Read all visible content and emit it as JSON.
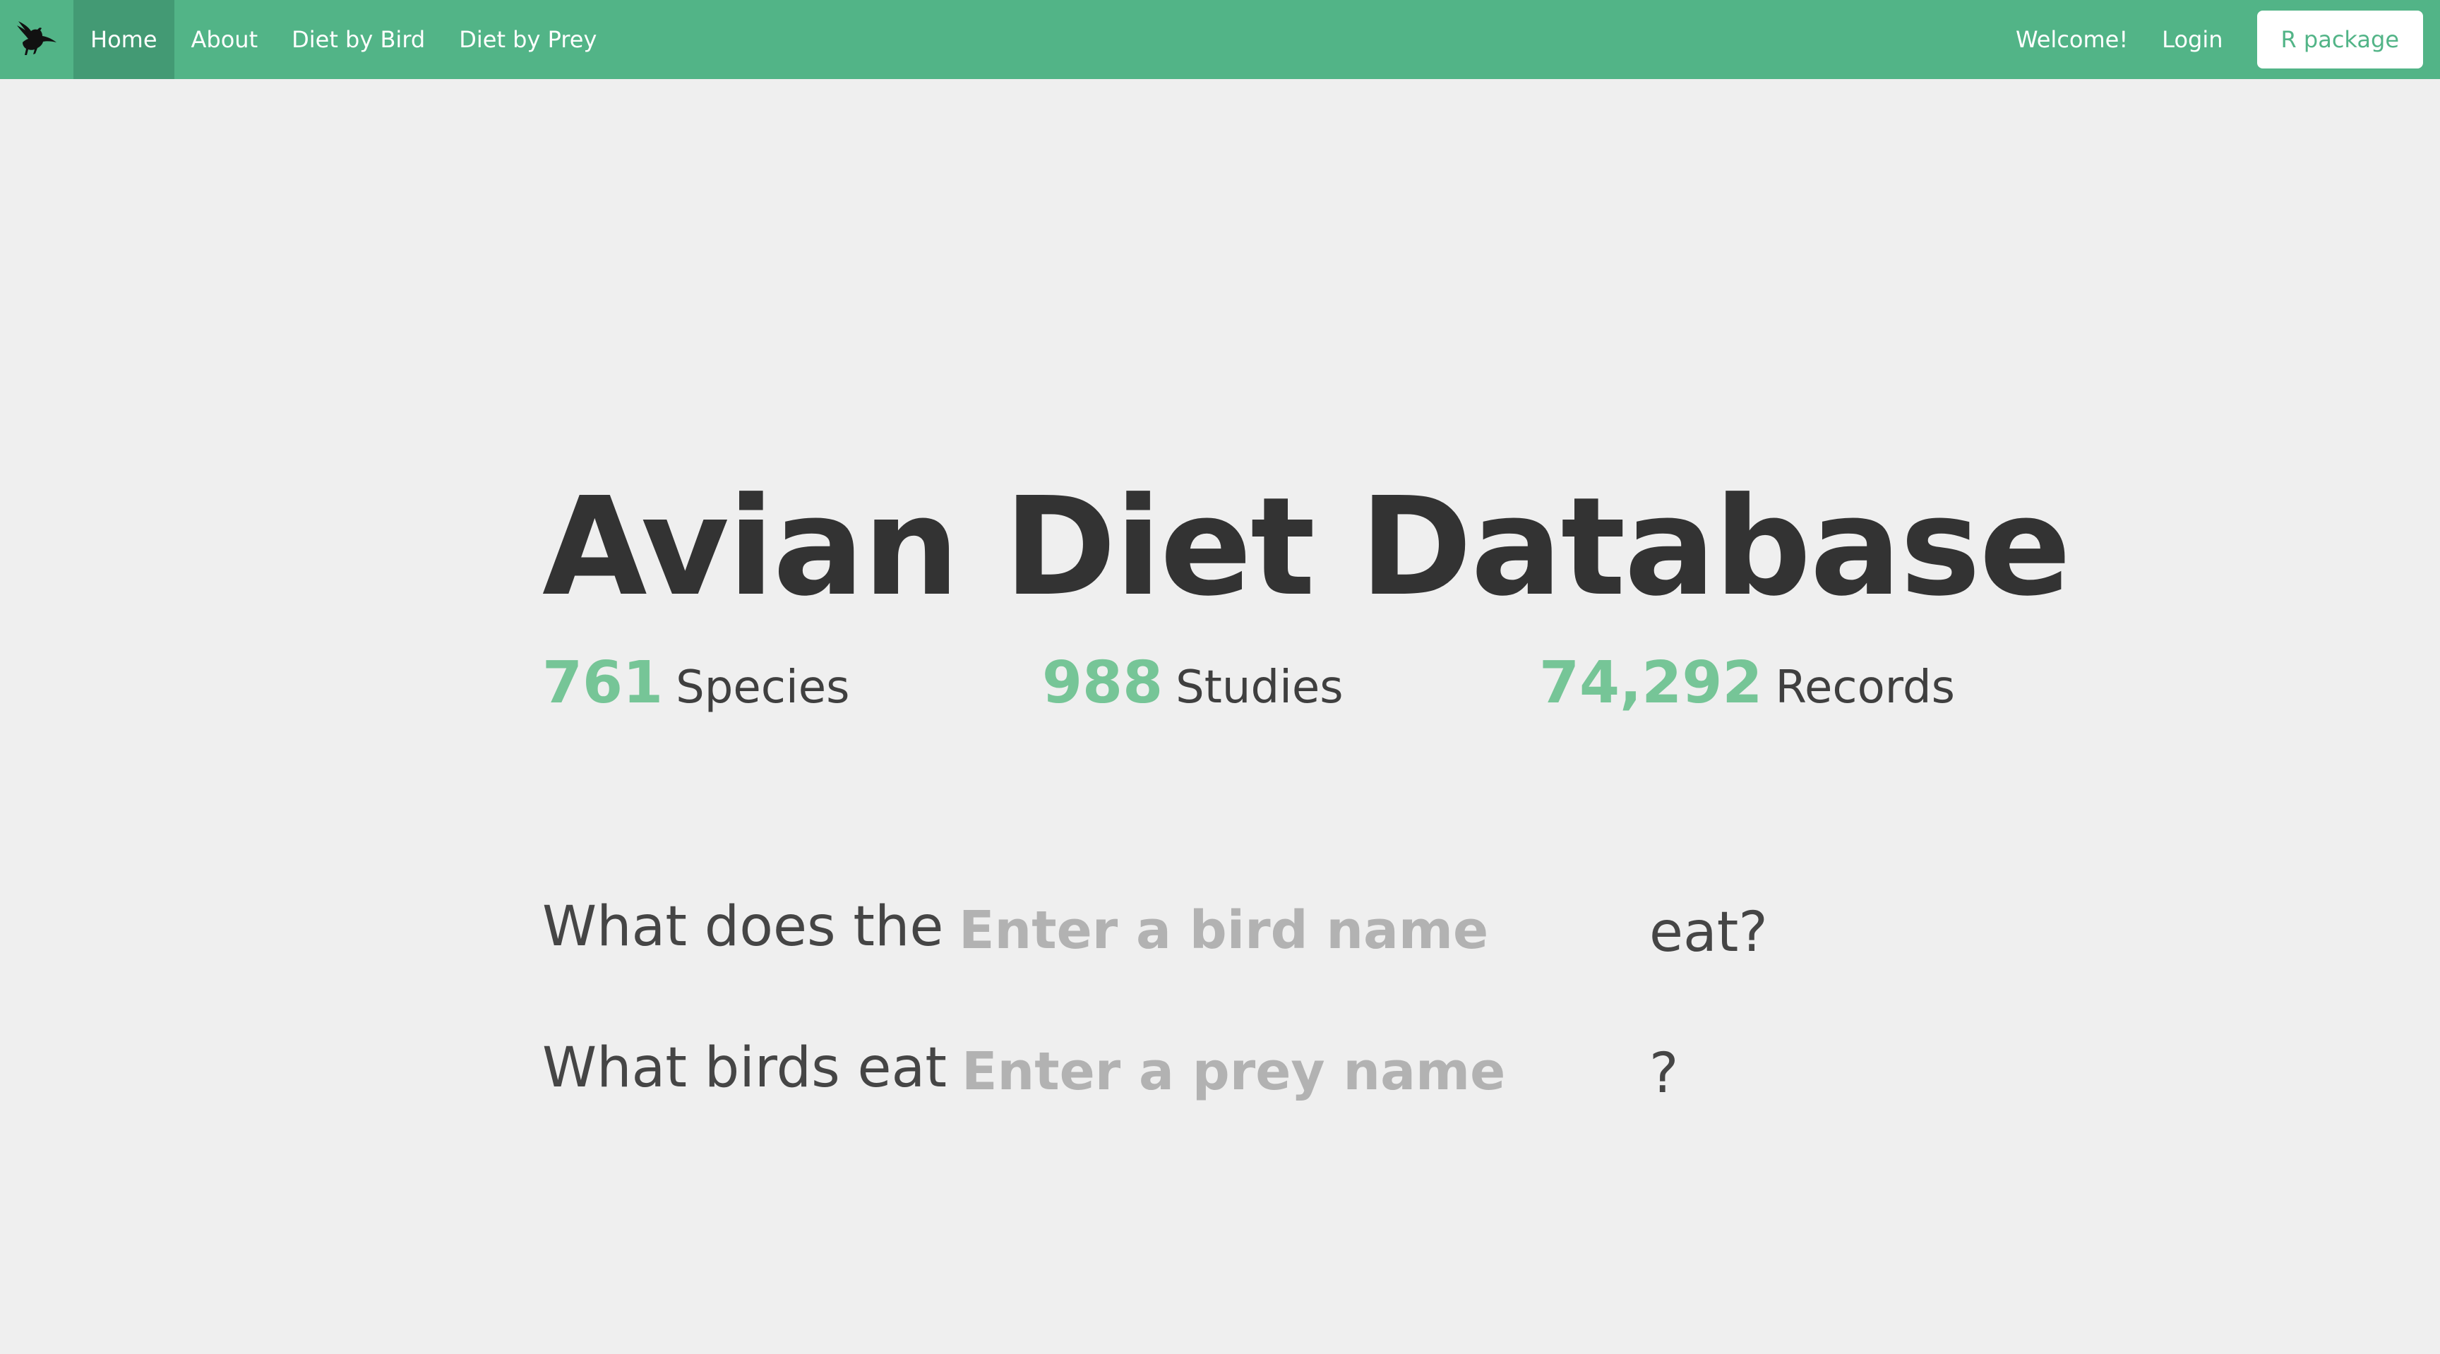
{
  "nav": {
    "logo_icon": "bird-silhouette-icon",
    "items": [
      {
        "label": "Home",
        "active": true
      },
      {
        "label": "About",
        "active": false
      },
      {
        "label": "Diet by Bird",
        "active": false
      },
      {
        "label": "Diet by Prey",
        "active": false
      }
    ],
    "welcome": "Welcome!",
    "login": "Login",
    "r_package": "R package"
  },
  "hero": {
    "title": "Avian Diet Database"
  },
  "stats": [
    {
      "number": "761",
      "label": "Species"
    },
    {
      "number": "988",
      "label": "Studies"
    },
    {
      "number": "74,292",
      "label": "Records"
    }
  ],
  "queries": {
    "bird": {
      "prefix": "What does the",
      "placeholder": "Enter a bird name",
      "value": "",
      "suffix": "eat?"
    },
    "prey": {
      "prefix": "What birds eat",
      "placeholder": "Enter a prey name",
      "value": "",
      "suffix": "?"
    }
  },
  "colors": {
    "navbar": "#52b487",
    "nav_active": "#439a74",
    "stat_number": "#76c597",
    "background": "#efefef"
  }
}
